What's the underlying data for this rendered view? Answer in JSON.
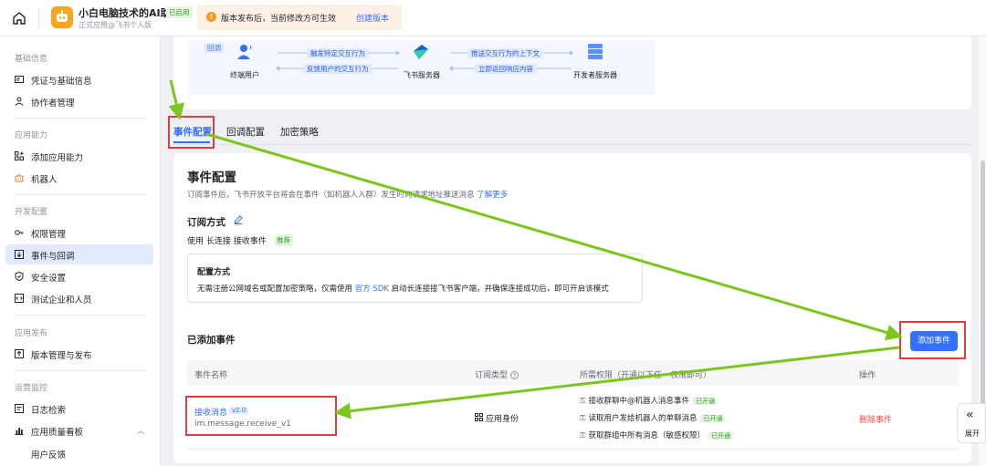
{
  "app": {
    "name": "小白电脑技术的AI助手",
    "badge": "已启用",
    "subtitle": "正式应用@飞书个人版"
  },
  "notice": {
    "text": "版本发布后，当前修改方可生效",
    "link": "创建版本"
  },
  "sidebar": {
    "sections": [
      {
        "title": "基础信息",
        "items": [
          "凭证与基础信息",
          "协作者管理"
        ]
      },
      {
        "title": "应用能力",
        "items": [
          "添加应用能力",
          "机器人"
        ]
      },
      {
        "title": "开发配置",
        "items": [
          "权限管理",
          "事件与回调",
          "安全设置",
          "测试企业和人员"
        ]
      },
      {
        "title": "应用发布",
        "items": [
          "版本管理与发布"
        ]
      },
      {
        "title": "运营监控",
        "items": [
          "日志检索",
          "应用质量看板",
          "用户反馈"
        ]
      }
    ]
  },
  "flow": {
    "tag": "回调",
    "nodes": [
      "终端用户",
      "飞书服务器",
      "开发者服务器"
    ],
    "labels": [
      "触发特定交互行为",
      "反馈用户的交互行为",
      "推送交互行为的上下文",
      "立即返回响应内容"
    ]
  },
  "tabs": [
    "事件配置",
    "回调配置",
    "加密策略"
  ],
  "event_config": {
    "title": "事件配置",
    "desc": "订阅事件后，飞书开放平台将会在事件（如机器人入群）发生时向请求地址推送消息",
    "desc_link": "了解更多",
    "sub_title": "订阅方式",
    "mode_text": "使用 长连接 接收事件",
    "mode_badge": "推荐",
    "config_title": "配置方式",
    "config_text_a": "无需注册公网域名或配置加密策略，仅需使用",
    "config_link": "官方 SDK",
    "config_text_b": "启动长连接接飞书客户端，并确保连接成功后，即可开启该模式",
    "added_title": "已添加事件",
    "add_button": "添加事件"
  },
  "table": {
    "headers": [
      "事件名称",
      "订阅类型",
      "所需权限（开通以下任一权限即可）",
      "操作"
    ],
    "rows": [
      {
        "name": "接收消息",
        "version": "v2.0",
        "key": "im.message.receive_v1",
        "type": "应用身份",
        "permissions": [
          {
            "text": "接收群聊中@机器人消息事件",
            "status": "已开通"
          },
          {
            "text": "读取用户发给机器人的单聊消息",
            "status": "已开通"
          },
          {
            "text": "获取群组中所有消息（敏感权限）",
            "status": "已开通"
          }
        ],
        "action": "删除事件"
      }
    ]
  },
  "expand_label": "展开",
  "colors": {
    "accent": "#3370ff",
    "annotation_red": "#e03e3e",
    "annotation_arrow": "#7cc51d"
  }
}
